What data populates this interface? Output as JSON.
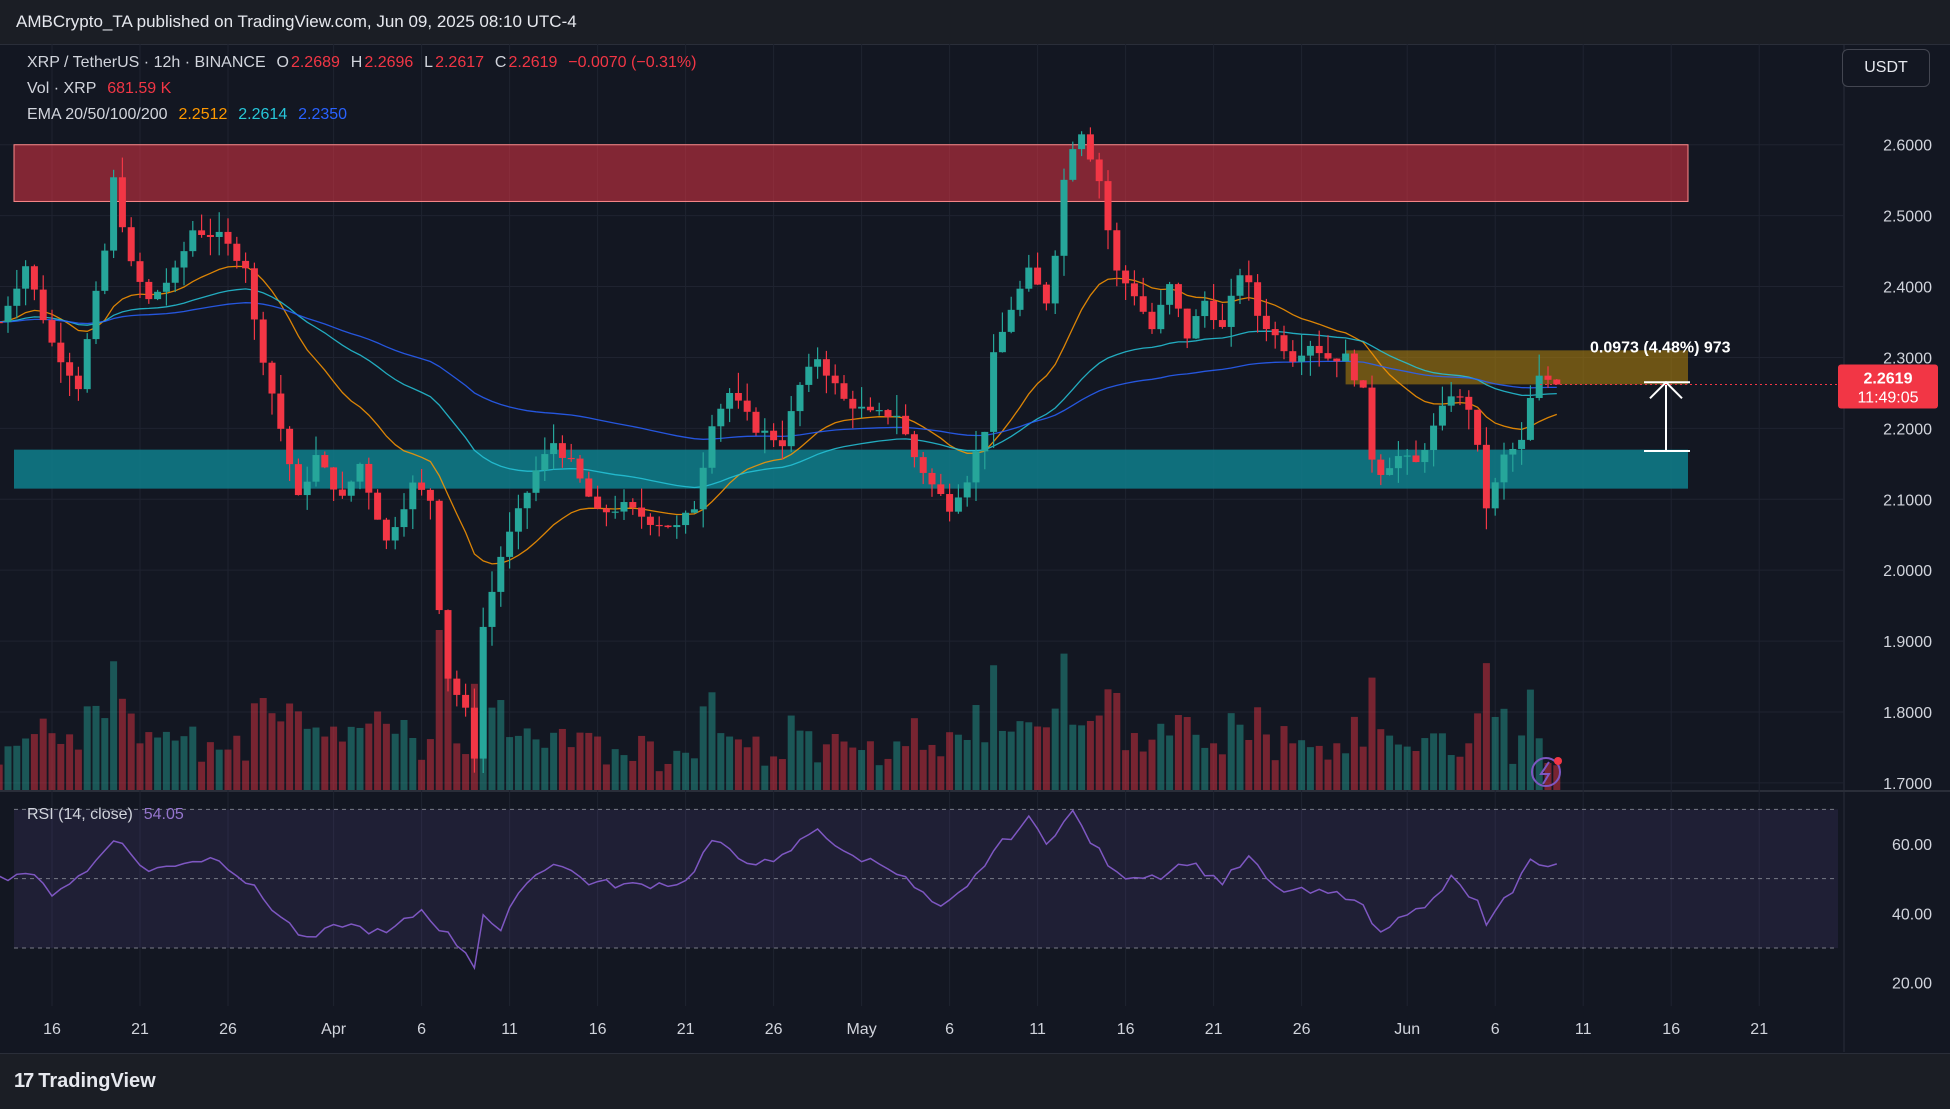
{
  "publish": {
    "text": "AMBCrypto_TA published on TradingView.com, Jun 09, 2025 08:10 UTC-4"
  },
  "currency": "USDT",
  "legend": {
    "symbol": "XRP / TetherUS · 12h · BINANCE",
    "o_label": "O",
    "o": "2.2689",
    "h_label": "H",
    "h": "2.2696",
    "l_label": "L",
    "l": "2.2617",
    "c_label": "C",
    "c": "2.2619",
    "change": "−0.0070 (−0.31%)",
    "vol_label": "Vol · XRP",
    "vol": "681.59 K",
    "ema_label": "EMA 20/50/100/200",
    "ema20": "2.2512",
    "ema50": "2.2614",
    "ema100": "2.2350",
    "rsi_label": "RSI (14, close)",
    "rsi": "54.05"
  },
  "measure_label": "0.0973 (4.48%) 973",
  "price_tag": {
    "price": "2.2619",
    "countdown": "11:49:05"
  },
  "footer": {
    "brand": "TradingView",
    "logo": "17"
  },
  "colors": {
    "up": "#26a69a",
    "down": "#f23645",
    "ema20": "#ff9800",
    "ema50": "#26c6da",
    "ema100": "#2962ff",
    "rsi": "#7e57c2",
    "resistance": "#f23645",
    "support": "#0f7f8c",
    "target": "#b8860b"
  },
  "chart_data": {
    "type": "candlestick",
    "title": "XRP / TetherUS · 12h · BINANCE",
    "y_ticks": [
      "2.6000",
      "2.5000",
      "2.4000",
      "2.3000",
      "2.2000",
      "2.1000",
      "2.0000",
      "1.9000",
      "1.8000",
      "1.7000"
    ],
    "ylim": [
      1.69,
      2.68
    ],
    "x_ticks": [
      "16",
      "21",
      "26",
      "Apr",
      "6",
      "11",
      "16",
      "21",
      "26",
      "May",
      "6",
      "11",
      "16",
      "21",
      "26",
      "Jun",
      "6",
      "11",
      "16",
      "21"
    ],
    "x_tick_dates": [
      "2025-03-16",
      "2025-03-21",
      "2025-03-26",
      "2025-04-01",
      "2025-04-06",
      "2025-04-11",
      "2025-04-16",
      "2025-04-21",
      "2025-04-26",
      "2025-05-01",
      "2025-05-06",
      "2025-05-11",
      "2025-05-16",
      "2025-05-21",
      "2025-05-26",
      "2025-06-01",
      "2025-06-06",
      "2025-06-11",
      "2025-06-16",
      "2025-06-21"
    ],
    "candle_interval": "12h",
    "first_candle": "2025-03-13 00:00",
    "anchors": [
      {
        "date": "2025-03-13 00:00",
        "close": 2.35
      },
      {
        "date": "2025-03-14 12:00",
        "close": 2.43
      },
      {
        "date": "2025-03-16 00:00",
        "close": 2.32
      },
      {
        "date": "2025-03-17 12:00",
        "close": 2.26
      },
      {
        "date": "2025-03-19 00:00",
        "close": 2.45
      },
      {
        "date": "2025-03-19 12:00",
        "close": 2.55
      },
      {
        "date": "2025-03-20 12:00",
        "close": 2.43
      },
      {
        "date": "2025-03-21 12:00",
        "close": 2.38
      },
      {
        "date": "2025-03-23 00:00",
        "close": 2.42
      },
      {
        "date": "2025-03-24 00:00",
        "close": 2.48
      },
      {
        "date": "2025-03-25 12:00",
        "close": 2.47
      },
      {
        "date": "2025-03-27 00:00",
        "close": 2.43
      },
      {
        "date": "2025-03-27 12:00",
        "close": 2.35
      },
      {
        "date": "2025-03-29 00:00",
        "close": 2.2
      },
      {
        "date": "2025-03-30 00:00",
        "close": 2.1
      },
      {
        "date": "2025-03-31 00:00",
        "close": 2.16
      },
      {
        "date": "2025-04-01 12:00",
        "close": 2.1
      },
      {
        "date": "2025-04-02 12:00",
        "close": 2.15
      },
      {
        "date": "2025-04-04 00:00",
        "close": 2.04
      },
      {
        "date": "2025-04-05 12:00",
        "close": 2.12
      },
      {
        "date": "2025-04-06 12:00",
        "close": 2.1
      },
      {
        "date": "2025-04-07 00:00",
        "close": 1.95
      },
      {
        "date": "2025-04-07 12:00",
        "close": 1.85
      },
      {
        "date": "2025-04-08 12:00",
        "close": 1.8
      },
      {
        "date": "2025-04-09 00:00",
        "close": 1.74
      },
      {
        "date": "2025-04-09 12:00",
        "close": 1.92
      },
      {
        "date": "2025-04-10 12:00",
        "close": 2.02
      },
      {
        "date": "2025-04-11 12:00",
        "close": 2.08
      },
      {
        "date": "2025-04-12 12:00",
        "close": 2.14
      },
      {
        "date": "2025-04-13 12:00",
        "close": 2.18
      },
      {
        "date": "2025-04-14 12:00",
        "close": 2.15
      },
      {
        "date": "2025-04-16 00:00",
        "close": 2.08
      },
      {
        "date": "2025-04-17 12:00",
        "close": 2.09
      },
      {
        "date": "2025-04-19 00:00",
        "close": 2.07
      },
      {
        "date": "2025-04-20 12:00",
        "close": 2.06
      },
      {
        "date": "2025-04-21 12:00",
        "close": 2.09
      },
      {
        "date": "2025-04-22 12:00",
        "close": 2.21
      },
      {
        "date": "2025-04-23 12:00",
        "close": 2.25
      },
      {
        "date": "2025-04-25 00:00",
        "close": 2.2
      },
      {
        "date": "2025-04-26 12:00",
        "close": 2.18
      },
      {
        "date": "2025-04-27 12:00",
        "close": 2.26
      },
      {
        "date": "2025-04-28 12:00",
        "close": 2.3
      },
      {
        "date": "2025-04-30 00:00",
        "close": 2.24
      },
      {
        "date": "2025-05-01 12:00",
        "close": 2.22
      },
      {
        "date": "2025-05-03 00:00",
        "close": 2.22
      },
      {
        "date": "2025-05-04 00:00",
        "close": 2.16
      },
      {
        "date": "2025-05-05 00:00",
        "close": 2.12
      },
      {
        "date": "2025-05-06 00:00",
        "close": 2.09
      },
      {
        "date": "2025-05-07 00:00",
        "close": 2.13
      },
      {
        "date": "2025-05-08 00:00",
        "close": 2.2
      },
      {
        "date": "2025-05-08 12:00",
        "close": 2.3
      },
      {
        "date": "2025-05-09 12:00",
        "close": 2.37
      },
      {
        "date": "2025-05-10 12:00",
        "close": 2.42
      },
      {
        "date": "2025-05-11 12:00",
        "close": 2.38
      },
      {
        "date": "2025-05-12 00:00",
        "close": 2.45
      },
      {
        "date": "2025-05-12 12:00",
        "close": 2.55
      },
      {
        "date": "2025-05-13 00:00",
        "close": 2.6
      },
      {
        "date": "2025-05-13 12:00",
        "close": 2.62
      },
      {
        "date": "2025-05-14 12:00",
        "close": 2.55
      },
      {
        "date": "2025-05-15 00:00",
        "close": 2.48
      },
      {
        "date": "2025-05-15 12:00",
        "close": 2.42
      },
      {
        "date": "2025-05-16 12:00",
        "close": 2.39
      },
      {
        "date": "2025-05-17 12:00",
        "close": 2.34
      },
      {
        "date": "2025-05-18 12:00",
        "close": 2.4
      },
      {
        "date": "2025-05-19 12:00",
        "close": 2.33
      },
      {
        "date": "2025-05-20 12:00",
        "close": 2.38
      },
      {
        "date": "2025-05-21 12:00",
        "close": 2.34
      },
      {
        "date": "2025-05-22 12:00",
        "close": 2.42
      },
      {
        "date": "2025-05-23 00:00",
        "close": 2.4
      },
      {
        "date": "2025-05-23 12:00",
        "close": 2.36
      },
      {
        "date": "2025-05-24 12:00",
        "close": 2.33
      },
      {
        "date": "2025-05-25 12:00",
        "close": 2.3
      },
      {
        "date": "2025-05-26 12:00",
        "close": 2.32
      },
      {
        "date": "2025-05-27 12:00",
        "close": 2.3
      },
      {
        "date": "2025-05-28 12:00",
        "close": 2.3
      },
      {
        "date": "2025-05-29 12:00",
        "close": 2.25
      },
      {
        "date": "2025-05-30 00:00",
        "close": 2.16
      },
      {
        "date": "2025-05-30 12:00",
        "close": 2.14
      },
      {
        "date": "2025-05-31 12:00",
        "close": 2.16
      },
      {
        "date": "2025-06-01 12:00",
        "close": 2.15
      },
      {
        "date": "2025-06-02 12:00",
        "close": 2.2
      },
      {
        "date": "2025-06-03 12:00",
        "close": 2.25
      },
      {
        "date": "2025-06-04 12:00",
        "close": 2.23
      },
      {
        "date": "2025-06-05 00:00",
        "close": 2.17
      },
      {
        "date": "2025-06-05 12:00",
        "close": 2.09
      },
      {
        "date": "2025-06-06 00:00",
        "close": 2.12
      },
      {
        "date": "2025-06-06 12:00",
        "close": 2.16
      },
      {
        "date": "2025-06-07 12:00",
        "close": 2.18
      },
      {
        "date": "2025-06-08 00:00",
        "close": 2.24
      },
      {
        "date": "2025-06-08 12:00",
        "close": 2.27
      },
      {
        "date": "2025-06-09 00:00",
        "close": 2.2689
      },
      {
        "date": "2025-06-09 12:00",
        "close": 2.2619
      }
    ],
    "zones": [
      {
        "name": "resistance",
        "from": 2.52,
        "to": 2.6
      },
      {
        "name": "target",
        "from": 2.262,
        "to": 2.31
      },
      {
        "name": "support",
        "from": 2.115,
        "to": 2.17
      }
    ],
    "measure": {
      "from": 2.168,
      "to": 2.265,
      "text": "0.0973 (4.48%) 973"
    },
    "ema_last": {
      "ema20": 2.2512,
      "ema50": 2.2614,
      "ema100": 2.235
    },
    "rsi": {
      "ticks": [
        "60.00",
        "40.00",
        "20.00"
      ],
      "ylim": [
        15,
        75
      ],
      "bands": [
        30,
        50,
        70
      ],
      "anchors": [
        {
          "date": "2025-03-13 00:00",
          "v": 50
        },
        {
          "date": "2025-03-14 12:00",
          "v": 52
        },
        {
          "date": "2025-03-16 00:00",
          "v": 46
        },
        {
          "date": "2025-03-18 00:00",
          "v": 52
        },
        {
          "date": "2025-03-19 12:00",
          "v": 62
        },
        {
          "date": "2025-03-21 12:00",
          "v": 52
        },
        {
          "date": "2025-03-23 12:00",
          "v": 55
        },
        {
          "date": "2025-03-25 12:00",
          "v": 56
        },
        {
          "date": "2025-03-27 12:00",
          "v": 47
        },
        {
          "date": "2025-03-29 00:00",
          "v": 39
        },
        {
          "date": "2025-03-30 12:00",
          "v": 32
        },
        {
          "date": "2025-04-01 12:00",
          "v": 37
        },
        {
          "date": "2025-04-04 00:00",
          "v": 34
        },
        {
          "date": "2025-04-06 00:00",
          "v": 41
        },
        {
          "date": "2025-04-07 00:00",
          "v": 36
        },
        {
          "date": "2025-04-08 12:00",
          "v": 29
        },
        {
          "date": "2025-04-09 00:00",
          "v": 25
        },
        {
          "date": "2025-04-09 12:00",
          "v": 40
        },
        {
          "date": "2025-04-10 12:00",
          "v": 34
        },
        {
          "date": "2025-04-11 12:00",
          "v": 47
        },
        {
          "date": "2025-04-13 12:00",
          "v": 55
        },
        {
          "date": "2025-04-15 12:00",
          "v": 49
        },
        {
          "date": "2025-04-18 00:00",
          "v": 48
        },
        {
          "date": "2025-04-21 00:00",
          "v": 49
        },
        {
          "date": "2025-04-22 12:00",
          "v": 61
        },
        {
          "date": "2025-04-24 00:00",
          "v": 56
        },
        {
          "date": "2025-04-26 00:00",
          "v": 54
        },
        {
          "date": "2025-04-28 12:00",
          "v": 65
        },
        {
          "date": "2025-04-30 00:00",
          "v": 57
        },
        {
          "date": "2025-05-02 12:00",
          "v": 54
        },
        {
          "date": "2025-05-05 12:00",
          "v": 41
        },
        {
          "date": "2025-05-07 00:00",
          "v": 47
        },
        {
          "date": "2025-05-08 12:00",
          "v": 58
        },
        {
          "date": "2025-05-10 12:00",
          "v": 67
        },
        {
          "date": "2025-05-11 12:00",
          "v": 61
        },
        {
          "date": "2025-05-13 00:00",
          "v": 69
        },
        {
          "date": "2025-05-14 00:00",
          "v": 61
        },
        {
          "date": "2025-05-15 12:00",
          "v": 51
        },
        {
          "date": "2025-05-18 00:00",
          "v": 51
        },
        {
          "date": "2025-05-19 12:00",
          "v": 55
        },
        {
          "date": "2025-05-21 12:00",
          "v": 49
        },
        {
          "date": "2025-05-23 00:00",
          "v": 56
        },
        {
          "date": "2025-05-24 12:00",
          "v": 47
        },
        {
          "date": "2025-05-26 12:00",
          "v": 46
        },
        {
          "date": "2025-05-29 00:00",
          "v": 45
        },
        {
          "date": "2025-05-30 12:00",
          "v": 34
        },
        {
          "date": "2025-05-31 12:00",
          "v": 40
        },
        {
          "date": "2025-06-02 00:00",
          "v": 41
        },
        {
          "date": "2025-06-03 12:00",
          "v": 50
        },
        {
          "date": "2025-06-05 00:00",
          "v": 43
        },
        {
          "date": "2025-06-05 12:00",
          "v": 36
        },
        {
          "date": "2025-06-07 00:00",
          "v": 47
        },
        {
          "date": "2025-06-08 00:00",
          "v": 55
        },
        {
          "date": "2025-06-09 12:00",
          "v": 54.05
        }
      ]
    }
  }
}
